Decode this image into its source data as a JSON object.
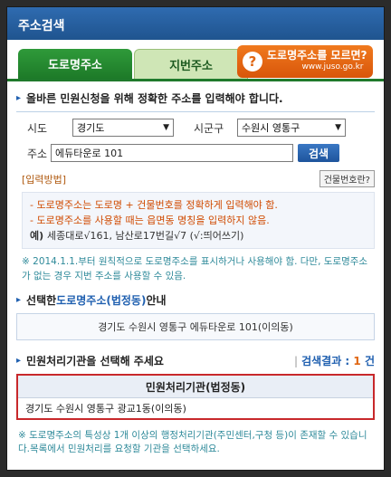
{
  "window": {
    "title": "주소검색"
  },
  "tabs": [
    {
      "label": "도로명주소",
      "active": true
    },
    {
      "label": "지번주소",
      "active": false
    }
  ],
  "juso_link": {
    "icon": "question-icon",
    "label": "도로명주소를 모르면?",
    "url": "www.juso.go.kr"
  },
  "instruction": {
    "before": "올바른 민원신청을 위해 정확한 주소를 입력해야 합니다."
  },
  "form": {
    "sido_label": "시도",
    "sido_value": "경기도",
    "sigungu_label": "시군구",
    "sigungu_value": "수원시 영통구",
    "address_label": "주소",
    "address_value": "에듀타운로 101",
    "search_button": "검색"
  },
  "input_guide": {
    "title": "[입력방법]",
    "building_button": "건물번호란?",
    "lines": [
      "- 도로명주소는 도로명 + 건물번호를 정확하게 입력해야 함.",
      "- 도로명주소를 사용할 때는 읍면동 명칭을 입력하지 않음."
    ],
    "example_label": "예)",
    "example_text": "세종대로√161, 남산로17번길√7 (√:띄어쓰기)"
  },
  "notice": "※ 2014.1.1.부터 원칙적으로 도로명주소를 표시하거나 사용해야 함. 다만, 도로명주소가 없는 경우 지번 주소를 사용할 수 있음.",
  "selected_section": {
    "title_prefix": "선택한 ",
    "title_highlight": "도로명주소(법정동)",
    "title_suffix": "안내",
    "address": "경기도 수원시 영통구 에듀타운로 101(이의동)"
  },
  "org_section": {
    "title": "민원처리기관을 선택해 주세요",
    "result_label": "검색결과 :",
    "result_count": "1",
    "result_unit": "건",
    "table_header": "민원처리기관(법정동)",
    "rows": [
      "경기도 수원시 영통구 광교1동(이의동)"
    ]
  },
  "bottom_note": "※ 도로명주소의 특성상 1개 이상의 행정처리기관(주민센터,구청 등)이 존재할 수 있습니다.목록에서 민원처리를 요청할 기관을 선택하세요."
}
